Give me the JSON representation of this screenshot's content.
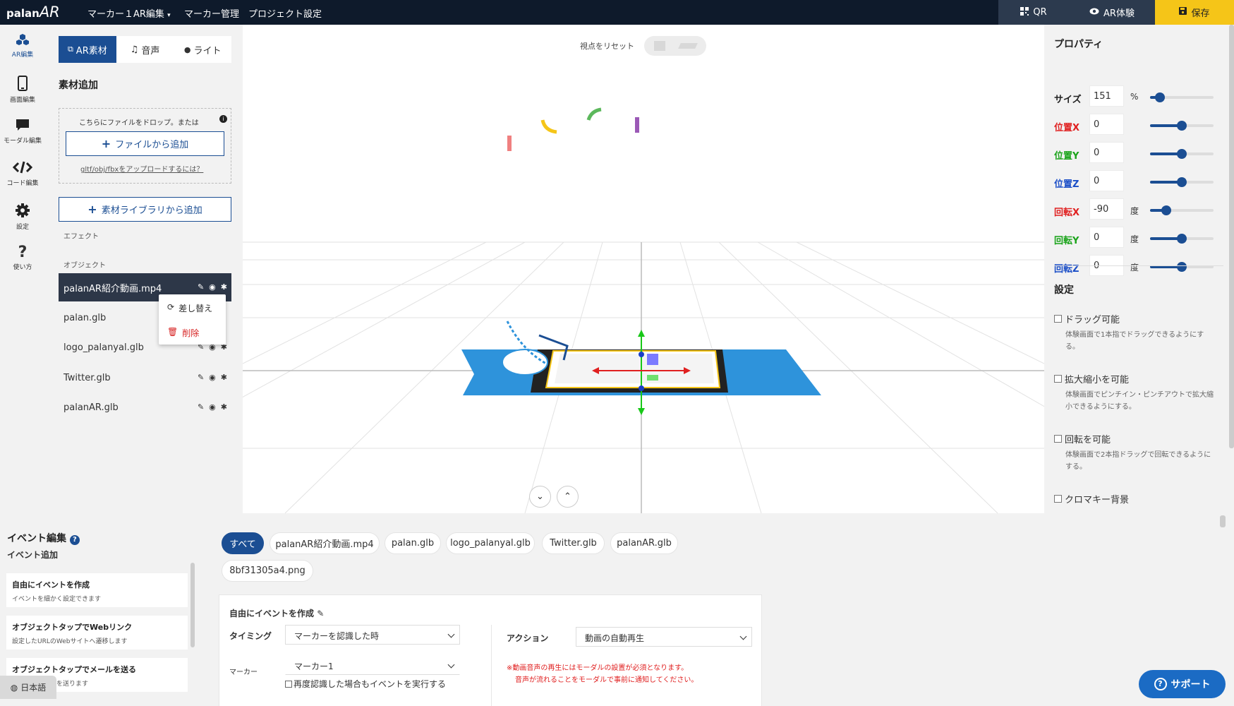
{
  "app": {
    "logo_main": "palan",
    "logo_ar": "AR"
  },
  "topbar": {
    "menu": [
      "マーカー１AR編集",
      "マーカー管理",
      "プロジェクト設定"
    ],
    "qr_label": "QR",
    "ar_experience_label": "AR体験",
    "save_label": "保存",
    "colors": {
      "bar": "#0e1a2b",
      "save": "#f5c518",
      "qr_bg": "#2c3a4e"
    }
  },
  "rail": [
    {
      "label": "AR編集",
      "icon": "cubes-icon",
      "active": true
    },
    {
      "label": "画面編集",
      "icon": "phone-icon"
    },
    {
      "label": "モーダル編集",
      "icon": "chat-icon"
    },
    {
      "label": "コード編集",
      "icon": "code-icon"
    },
    {
      "label": "設定",
      "icon": "gear-icon"
    },
    {
      "label": "使い方",
      "icon": "question-icon"
    }
  ],
  "assets": {
    "tabs": [
      "AR素材",
      "音声",
      "ライト"
    ],
    "add_title": "素材追加",
    "drop_text": "こちらにファイルをドロップ。または",
    "add_from_file": "ファイルから追加",
    "upload_help": "gltf/obj/fbxをアップロードするには？",
    "add_from_library": "素材ライブラリから追加",
    "effects_label": "エフェクト",
    "objects_label": "オブジェクト",
    "objects": [
      "palanAR紹介動画.mp4",
      "palan.glb",
      "logo_palanyal.glb",
      "Twitter.glb",
      "palanAR.glb"
    ],
    "context_menu": {
      "replace": "差し替え",
      "delete": "削除"
    }
  },
  "viewport": {
    "reset_view": "視点をリセット"
  },
  "properties": {
    "title": "プロパティ",
    "fields": [
      {
        "label": "サイズ",
        "value": "151",
        "unit": "%",
        "color": "#222",
        "slider": 0.15
      },
      {
        "label": "位置X",
        "value": "0",
        "unit": "",
        "color": "#e02020",
        "slider": 0.5
      },
      {
        "label": "位置Y",
        "value": "0",
        "unit": "",
        "color": "#1aa31a",
        "slider": 0.5
      },
      {
        "label": "位置Z",
        "value": "0",
        "unit": "",
        "color": "#1b4ec7",
        "slider": 0.5
      },
      {
        "label": "回転X",
        "value": "-90",
        "unit": "度",
        "color": "#e02020",
        "slider": 0.25
      },
      {
        "label": "回転Y",
        "value": "0",
        "unit": "度",
        "color": "#1aa31a",
        "slider": 0.5
      },
      {
        "label": "回転Z",
        "value": "0",
        "unit": "度",
        "color": "#1b4ec7",
        "slider": 0.5
      }
    ],
    "settings_title": "設定",
    "settings": [
      {
        "label": "ドラッグ可能",
        "desc": "体験画面で1本指でドラッグできるようにする。"
      },
      {
        "label": "拡大縮小を可能",
        "desc": "体験画面でピンチイン・ピンチアウトで拡大縮小できるようにする。"
      },
      {
        "label": "回転を可能",
        "desc": "体験画面で2本指ドラッグで回転できるようにする。"
      },
      {
        "label": "クロマキー背景",
        "desc": ""
      }
    ]
  },
  "events": {
    "title": "イベント編集",
    "add_label": "イベント追加",
    "templates": [
      {
        "title": "自由にイベントを作成",
        "desc": "イベントを細かく設定できます"
      },
      {
        "title": "オブジェクトタップでWebリンク",
        "desc": "設定したURLのWebサイトへ遷移します"
      },
      {
        "title": "オブジェクトタップでメールを送る",
        "desc": "ドレスにメールを送ります"
      }
    ],
    "filters": [
      "すべて",
      "palanAR紹介動画.mp4",
      "palan.glb",
      "logo_palanyal.glb",
      "Twitter.glb",
      "palanAR.glb",
      "8bf31305a4.png"
    ],
    "editor": {
      "title": "自由にイベントを作成",
      "timing_label": "タイミング",
      "timing_value": "マーカーを認識した時",
      "marker_label": "マーカー",
      "marker_value": "マーカー1",
      "repeat_label": "再度認識した場合もイベントを実行する",
      "action_label": "アクション",
      "action_value": "動画の自動再生",
      "warning_1": "※動画音声の再生にはモーダルの設置が必須となります。",
      "warning_2": "音声が流れることをモーダルで事前に通知してください。"
    }
  },
  "footer": {
    "language": "日本語",
    "support": "サポート"
  }
}
